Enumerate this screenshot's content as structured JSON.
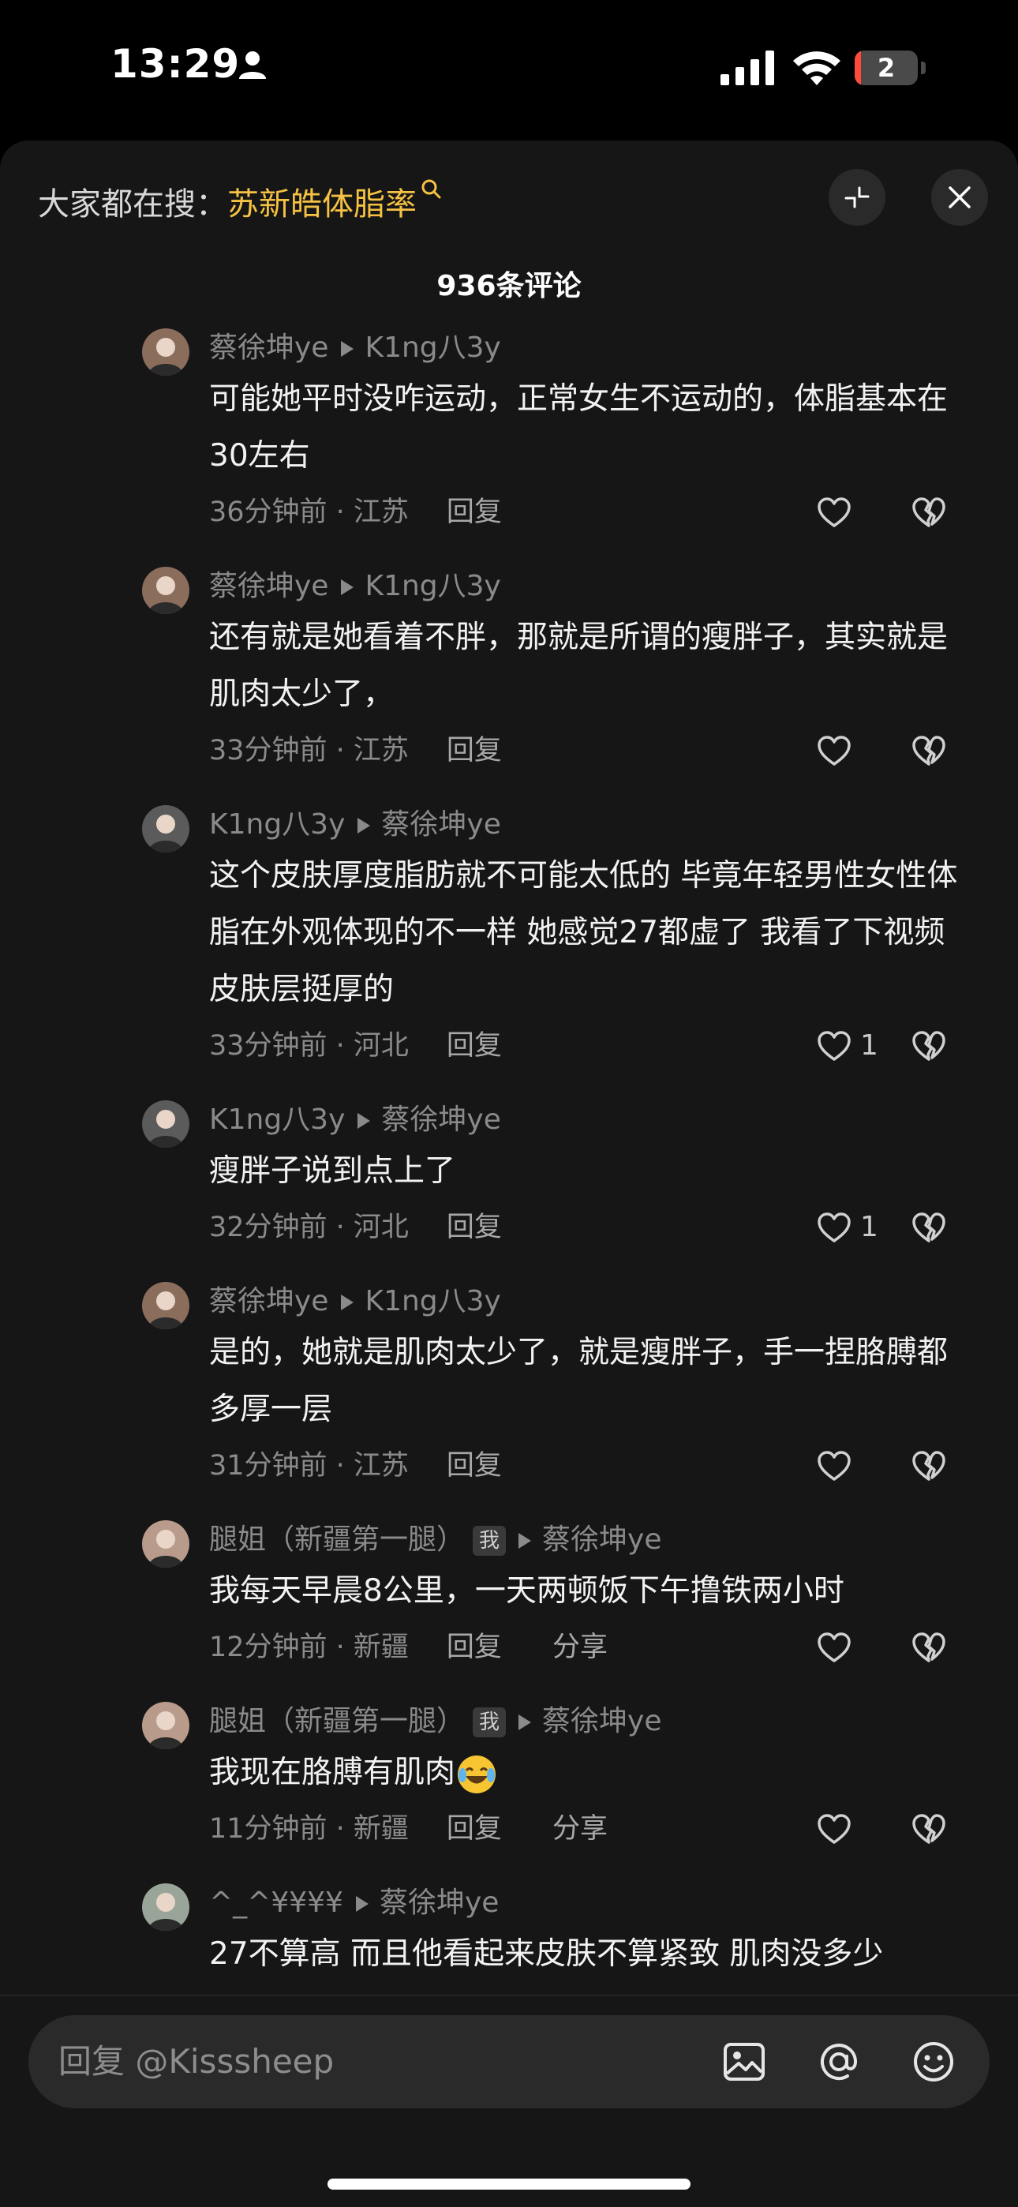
{
  "status": {
    "time": "13:29",
    "battery": "2",
    "battery_fraction": 0.1
  },
  "header": {
    "search_prefix": "大家都在搜：",
    "search_keyword": "苏新皓体脂率",
    "comment_count": "936条评论"
  },
  "comments": [
    {
      "author": "蔡徐坤ye",
      "reply_to": "K1ng八3y",
      "text": "可能她平时没咋运动，正常女生不运动的，体脂基本在30左右",
      "time_loc": "36分钟前 · 江苏",
      "reply": "回复",
      "share": "",
      "likes": ""
    },
    {
      "author": "蔡徐坤ye",
      "reply_to": "K1ng八3y",
      "text": "还有就是她看着不胖，那就是所谓的瘦胖子，其实就是肌肉太少了，",
      "time_loc": "33分钟前 · 江苏",
      "reply": "回复",
      "share": "",
      "likes": ""
    },
    {
      "author": "K1ng八3y",
      "reply_to": "蔡徐坤ye",
      "text": "这个皮肤厚度脂肪就不可能太低的 毕竟年轻男性女性体脂在外观体现的不一样 她感觉27都虚了 我看了下视频皮肤层挺厚的",
      "time_loc": "33分钟前 · 河北",
      "reply": "回复",
      "share": "",
      "likes": "1"
    },
    {
      "author": "K1ng八3y",
      "reply_to": "蔡徐坤ye",
      "text": "瘦胖子说到点上了",
      "time_loc": "32分钟前 · 河北",
      "reply": "回复",
      "share": "",
      "likes": "1"
    },
    {
      "author": "蔡徐坤ye",
      "reply_to": "K1ng八3y",
      "text": "是的，她就是肌肉太少了，就是瘦胖子，手一捏胳膊都多厚一层",
      "time_loc": "31分钟前 · 江苏",
      "reply": "回复",
      "share": "",
      "likes": ""
    },
    {
      "author": "腿姐（新疆第一腿）",
      "badge": "我",
      "reply_to": "蔡徐坤ye",
      "text": "我每天早晨8公里，一天两顿饭下午撸铁两小时",
      "time_loc": "12分钟前 · 新疆",
      "reply": "回复",
      "share": "分享",
      "likes": ""
    },
    {
      "author": "腿姐（新疆第一腿）",
      "badge": "我",
      "reply_to": "蔡徐坤ye",
      "text": "我现在胳膊有肌肉",
      "emoji": "laughing-crying-emoji",
      "time_loc": "11分钟前 · 新疆",
      "reply": "回复",
      "share": "分享",
      "likes": ""
    },
    {
      "author": "^_^¥¥¥¥",
      "reply_to": "蔡徐坤ye",
      "text": "27不算高 而且他看起来皮肤不算紧致 肌肉没多少",
      "time_loc": "",
      "reply": "",
      "share": "",
      "likes": ""
    }
  ],
  "composer": {
    "placeholder": "回复 @Kisssheep",
    "icons": [
      "image-icon",
      "at-icon",
      "emoji-icon"
    ]
  },
  "colors": {
    "keyword": "#f5c243",
    "sheet_bg": "#161616",
    "muted": "#8a8a8a"
  }
}
